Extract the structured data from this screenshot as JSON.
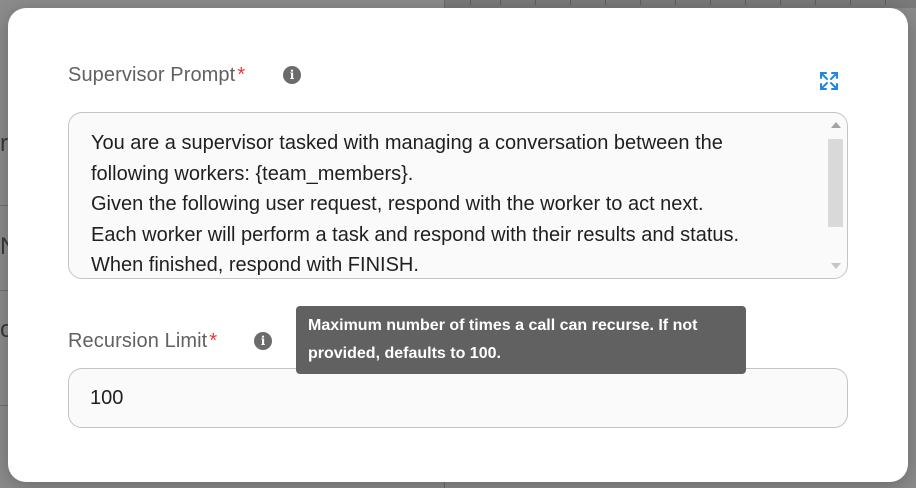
{
  "background": {
    "left_fragments": [
      "r",
      "N",
      "o"
    ]
  },
  "modal": {
    "supervisor_prompt": {
      "label": "Supervisor Prompt",
      "required_mark": "*",
      "info_icon": "info-icon",
      "expand_icon": "expand-icon",
      "lines": [
        "You are a supervisor tasked with managing a conversation between the",
        "following workers: {team_members}.",
        "Given the following user request, respond with the worker to act next.",
        "Each worker will perform a task and respond with their results and status.",
        "When finished, respond with FINISH."
      ]
    },
    "recursion_limit": {
      "label": "Recursion Limit",
      "required_mark": "*",
      "info_icon": "info-icon",
      "value": "100"
    },
    "tooltip": {
      "text": "Maximum number of times a call can recurse. If not provided, defaults to 100."
    }
  },
  "colors": {
    "required": "#e53935",
    "tooltip_bg": "#616161",
    "accent": "#1e88e5"
  }
}
